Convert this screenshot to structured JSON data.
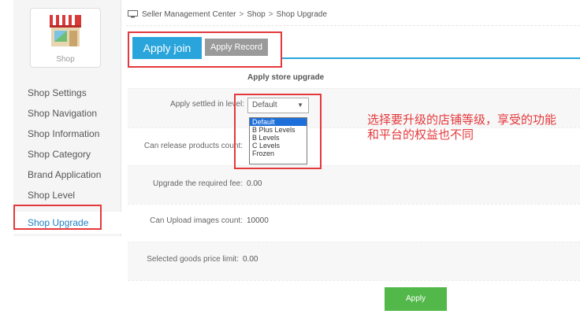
{
  "breadcrumb": {
    "icon": "monitor-icon",
    "items": [
      "Seller Management Center",
      "Shop",
      "Shop Upgrade"
    ],
    "separator": ">"
  },
  "sidebar": {
    "card_label": "Shop",
    "logo_icon": "storefront-icon",
    "items": [
      {
        "label": "Shop Settings"
      },
      {
        "label": "Shop Navigation"
      },
      {
        "label": "Shop Information"
      },
      {
        "label": "Shop Category"
      },
      {
        "label": "Brand Application"
      },
      {
        "label": "Shop Level"
      },
      {
        "label": "Shop Upgrade",
        "active": true
      }
    ]
  },
  "tabs": {
    "active": "Apply join",
    "other": "Apply Record"
  },
  "form": {
    "title": "Apply store upgrade",
    "level_label": "Apply settled in level:",
    "level_selected": "Default",
    "level_options": [
      "Default",
      "B Plus Levels",
      "B Levels",
      "C Levels",
      "Frozen"
    ],
    "products_label": "Can release products count:",
    "fee_label": "Upgrade the required fee:",
    "fee_value": "0.00",
    "images_label": "Can Upload images count:",
    "images_value": "10000",
    "price_limit_label": "Selected goods price limit:",
    "price_limit_value": "0.00",
    "submit_label": "Apply"
  },
  "annotation": {
    "text": "选择要升级的店铺等级，享受的功能和平台的权益也不同"
  },
  "colors": {
    "accent_blue": "#2aa5dc",
    "highlight_red": "#e4393c",
    "button_green": "#52b849",
    "active_link": "#1e7fc0"
  }
}
